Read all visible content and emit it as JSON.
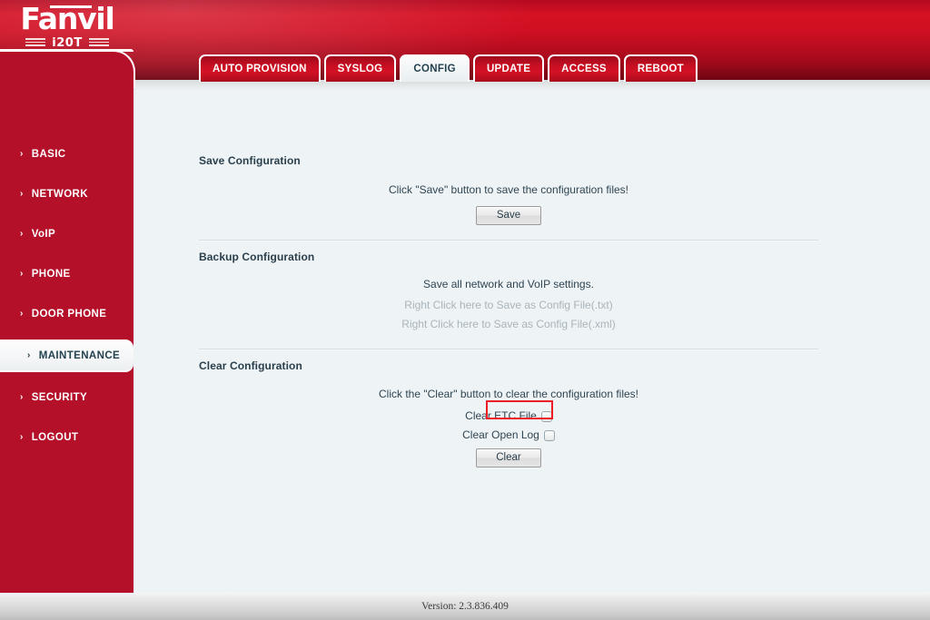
{
  "brand": {
    "name": "Fanvil",
    "model": "i20T"
  },
  "tabs": [
    {
      "label": "AUTO PROVISION",
      "active": false
    },
    {
      "label": "SYSLOG",
      "active": false
    },
    {
      "label": "CONFIG",
      "active": true
    },
    {
      "label": "UPDATE",
      "active": false
    },
    {
      "label": "ACCESS",
      "active": false
    },
    {
      "label": "REBOOT",
      "active": false
    }
  ],
  "sidebar": {
    "chevron": "›",
    "items": [
      {
        "label": "BASIC",
        "active": false
      },
      {
        "label": "NETWORK",
        "active": false
      },
      {
        "label": "VoIP",
        "active": false
      },
      {
        "label": "PHONE",
        "active": false
      },
      {
        "label": "DOOR PHONE",
        "active": false
      },
      {
        "label": "MAINTENANCE",
        "active": true
      },
      {
        "label": "SECURITY",
        "active": false
      },
      {
        "label": "LOGOUT",
        "active": false
      }
    ]
  },
  "main": {
    "save_section": {
      "title": "Save Configuration",
      "description": "Click \"Save\" button to save the configuration files!",
      "button_label": "Save"
    },
    "backup_section": {
      "title": "Backup Configuration",
      "description": "Save all network and VoIP settings.",
      "link_txt": "Right Click here to Save as Config File(.txt)",
      "link_xml": "Right Click here to Save as Config File(.xml)"
    },
    "clear_section": {
      "title": "Clear Configuration",
      "description": "Click the \"Clear\" button to clear the configuration files!",
      "checkbox_etc_label": "Clear ETC File",
      "checkbox_etc_checked": false,
      "checkbox_openlog_label": "Clear Open Log",
      "checkbox_openlog_checked": false,
      "button_label": "Clear"
    }
  },
  "footer": {
    "version": "Version: 2.3.836.409"
  },
  "colors": {
    "brand_red": "#b5102a",
    "header_red": "#d21124",
    "highlight_red": "#ee1c25",
    "content_bg": "#eef3f5",
    "text_dark": "#2a3f4c",
    "text_muted": "#a9b5bb"
  }
}
